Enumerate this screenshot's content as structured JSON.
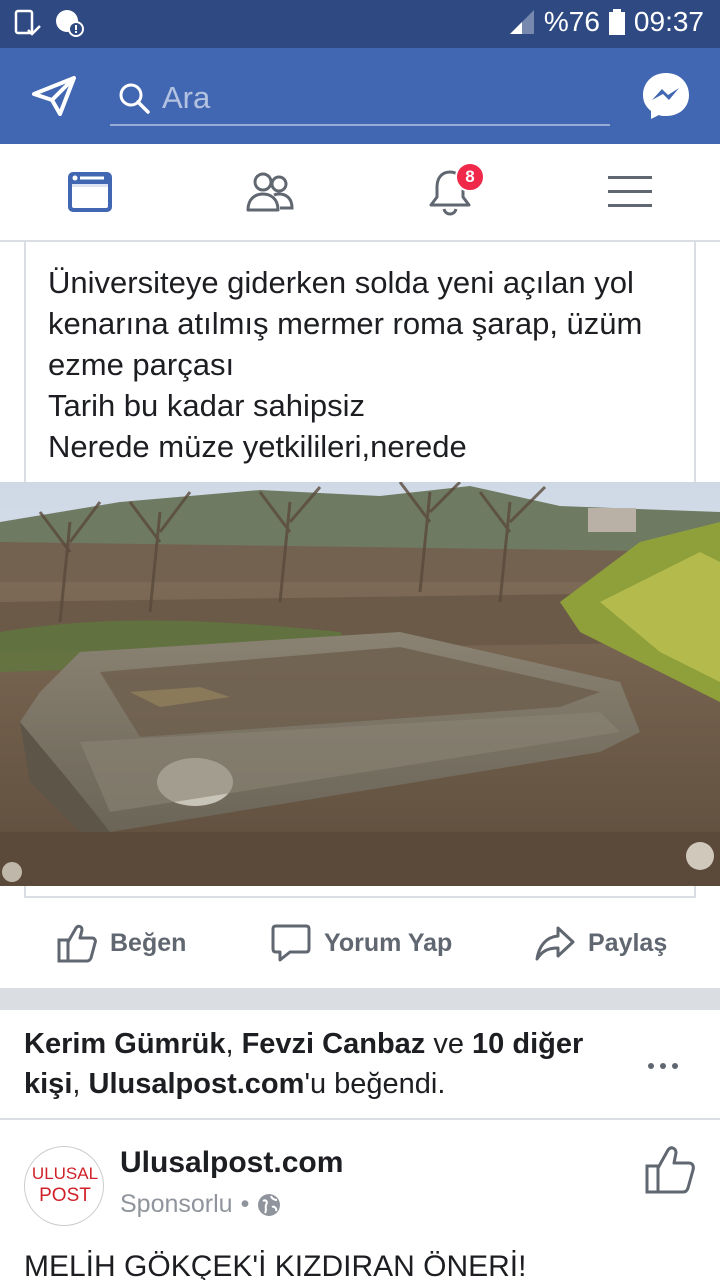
{
  "status_bar": {
    "battery": "%76",
    "time": "09:37"
  },
  "header": {
    "search_placeholder": "Ara"
  },
  "nav": {
    "notifications_count": "8"
  },
  "post": {
    "lines": [
      "Üniversiteye giderken solda yeni açılan yol",
      "kenarına atılmış mermer roma şarap, üzüm",
      "ezme parçası",
      "Tarih bu kadar sahipsiz",
      "Nerede müze yetkilileri,nerede"
    ],
    "actions": {
      "like": "Beğen",
      "comment": "Yorum Yap",
      "share": "Paylaş"
    }
  },
  "liked_by": {
    "name1": "Kerim Gümrük",
    "sep1": ", ",
    "name2": "Fevzi Canbaz",
    "and": " ve ",
    "others_a": "10 diğer",
    "others_b": "kişi",
    "sep2": ", ",
    "page": "Ulusalpost.com",
    "suffix": "'u beğendi."
  },
  "sponsored": {
    "logo_top": "ULUSAL",
    "logo_bottom": "POST",
    "page_name": "Ulusalpost.com",
    "label": "Sponsorlu",
    "dot": "•",
    "headline": "MELİH GÖKÇEK'İ KIZDIRAN ÖNERİ!"
  },
  "colors": {
    "status_bar": "#2f4a83",
    "header": "#4267b2",
    "active_tab": "#4267b2",
    "badge": "#f02849",
    "text": "#1c1e21",
    "muted": "#606770"
  }
}
